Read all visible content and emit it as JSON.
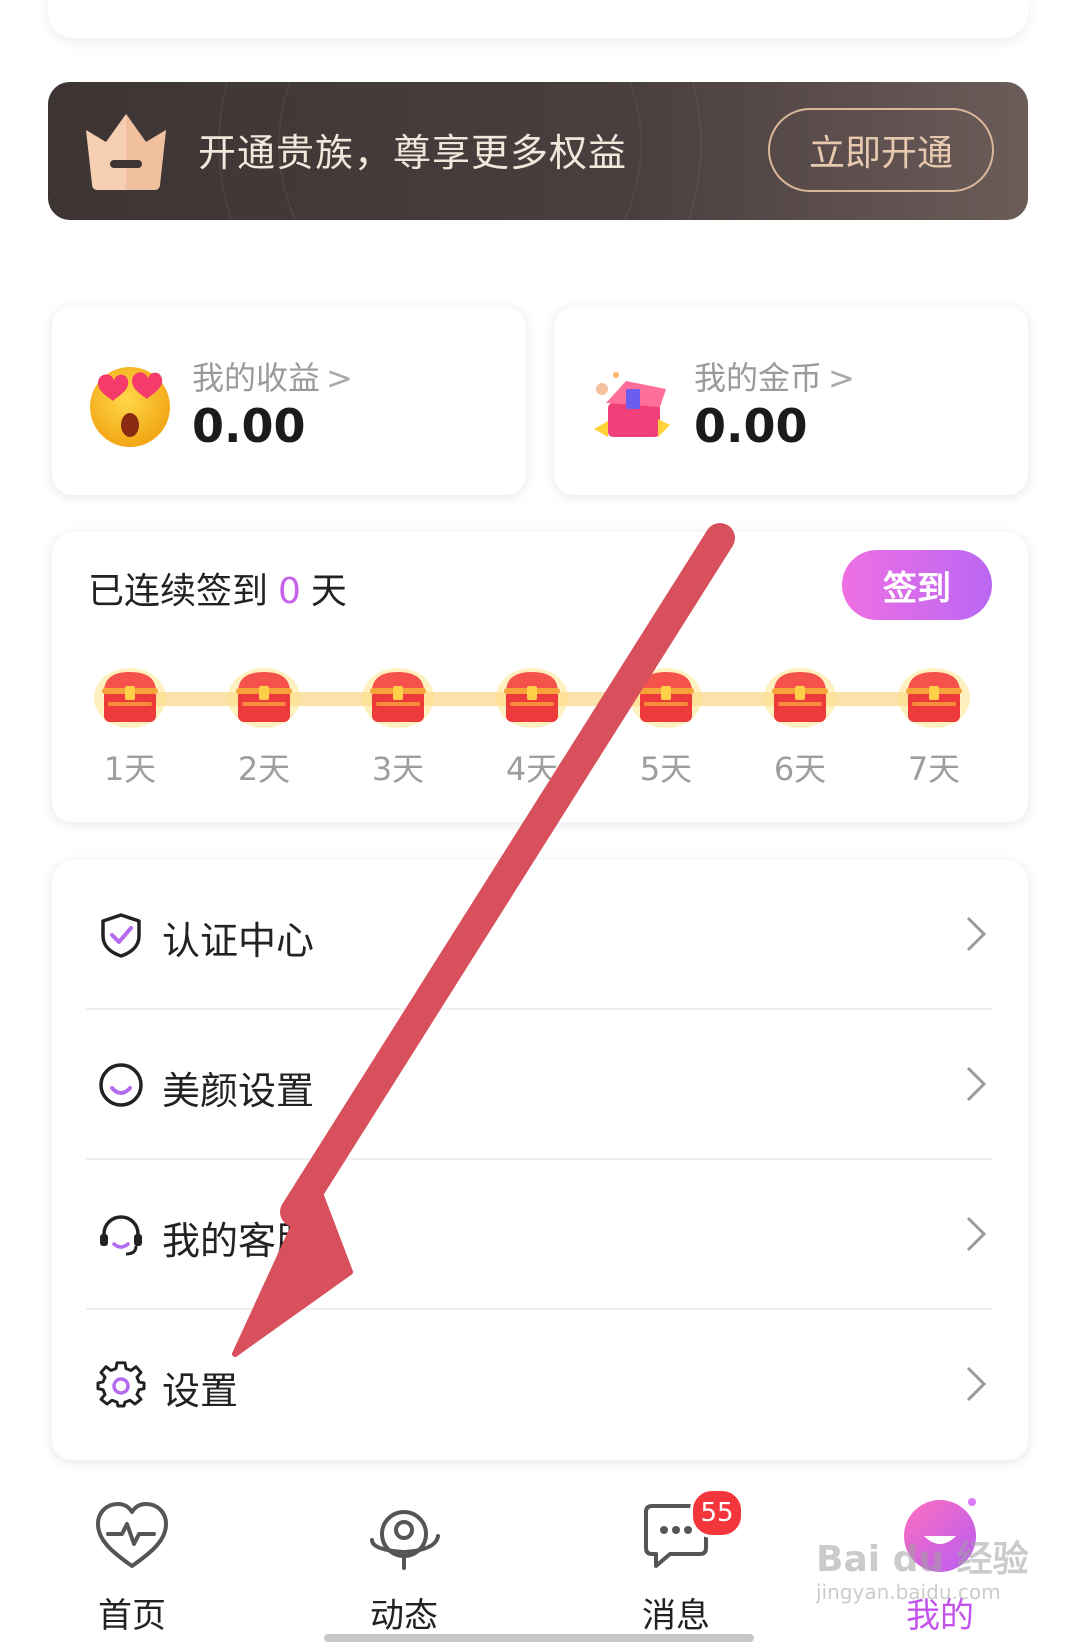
{
  "vip_banner": {
    "text": "开通贵族，尊享更多权益",
    "button_label": "立即开通",
    "icon": "crown-icon"
  },
  "stats": {
    "earnings": {
      "label": "我的收益",
      "value": "0.00",
      "icon": "heart-eyes-emoji-icon"
    },
    "coins": {
      "label": "我的金币",
      "value": "0.00",
      "icon": "gift-chest-icon"
    },
    "chevron": ">"
  },
  "signin": {
    "title_prefix": "已连续签到",
    "days": "0",
    "title_suffix": "天",
    "button_label": "签到",
    "days_list": [
      "1天",
      "2天",
      "3天",
      "4天",
      "5天",
      "6天",
      "7天"
    ]
  },
  "menu": {
    "items": [
      {
        "label": "认证中心",
        "icon": "shield-check-icon"
      },
      {
        "label": "美颜设置",
        "icon": "smile-icon"
      },
      {
        "label": "我的客服",
        "icon": "headset-icon"
      },
      {
        "label": "设置",
        "icon": "gear-icon"
      }
    ]
  },
  "tabbar": {
    "tabs": [
      {
        "label": "首页",
        "icon": "heart-pulse-icon"
      },
      {
        "label": "动态",
        "icon": "planet-icon"
      },
      {
        "label": "消息",
        "icon": "chat-bubble-icon",
        "badge": "55"
      },
      {
        "label": "我的",
        "icon": "profile-face-icon",
        "active": true
      }
    ]
  },
  "watermark": {
    "text": "Bai du 经验",
    "sub": "jingyan.baidu.com"
  },
  "colors": {
    "accent": "#c561ea",
    "banner_bg": "#3d3434",
    "badge": "#f2363c",
    "annotation_arrow": "#d8505c"
  }
}
